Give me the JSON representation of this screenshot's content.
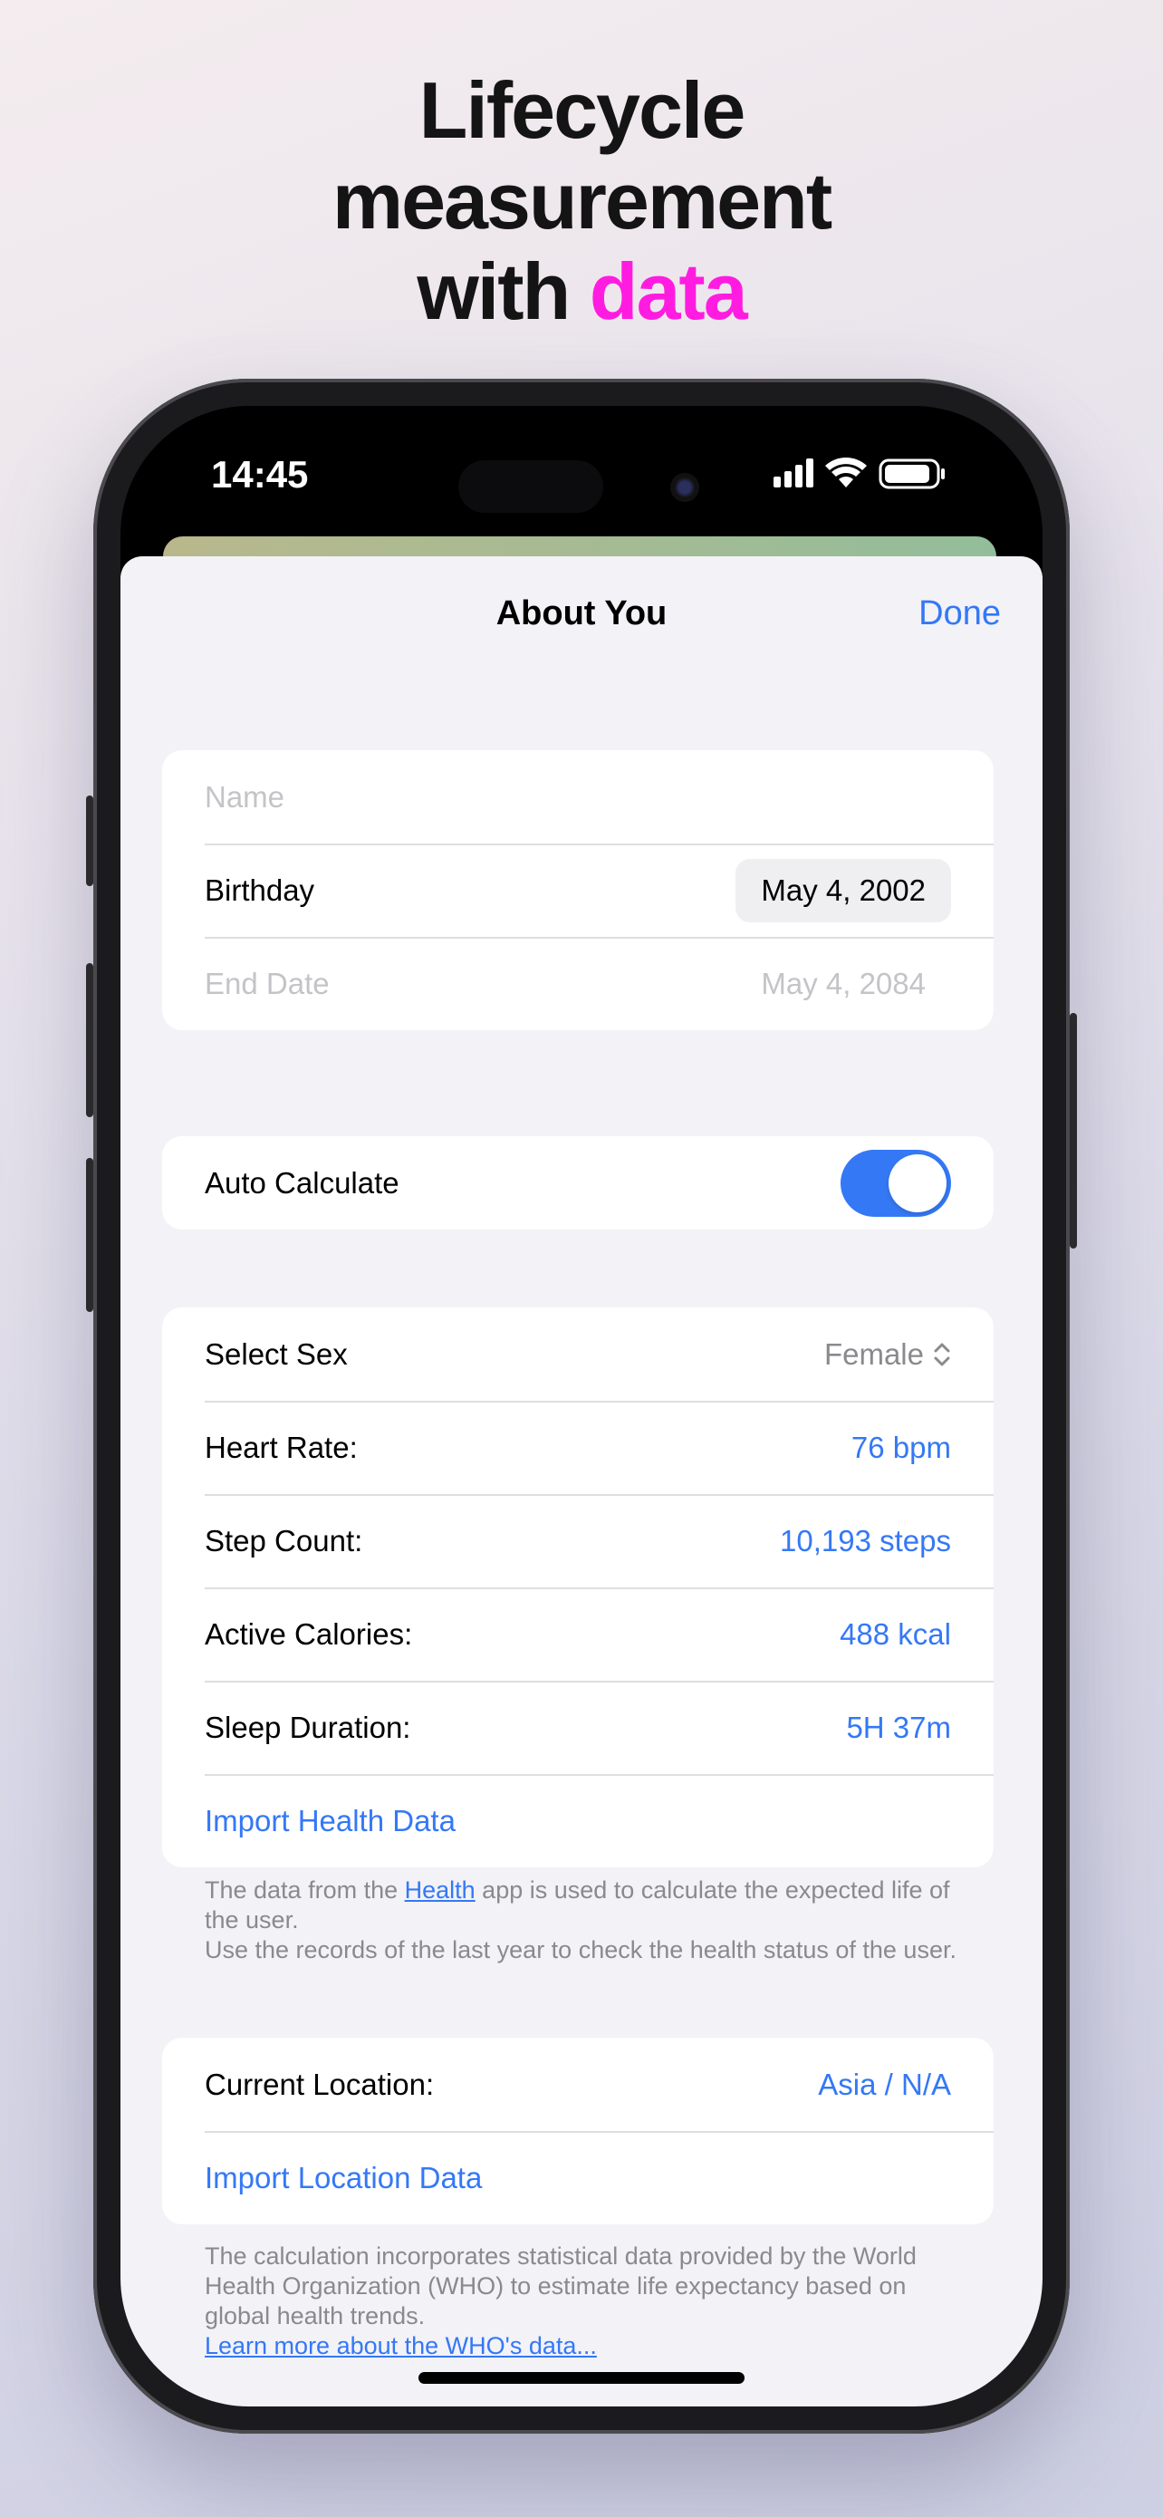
{
  "headline": {
    "line1": "Lifecycle",
    "line2": "measurement",
    "line3_prefix": "with ",
    "line3_accent": "data",
    "accent_color": "#ff1ce0"
  },
  "status_bar": {
    "time": "14:45",
    "icons": [
      "cellular-signal-icon",
      "wifi-icon",
      "battery-icon"
    ]
  },
  "nav": {
    "title": "About You",
    "done_label": "Done"
  },
  "profile": {
    "name_placeholder": "Name",
    "birthday_label": "Birthday",
    "birthday_value": "May 4, 2002",
    "end_date_label": "End Date",
    "end_date_value": "May 4, 2084"
  },
  "auto_calculate": {
    "label": "Auto Calculate",
    "enabled": true
  },
  "health": {
    "sex_label": "Select Sex",
    "sex_value": "Female",
    "heart_rate_label": "Heart Rate:",
    "heart_rate_value": "76 bpm",
    "step_count_label": "Step Count:",
    "step_count_value": "10,193 steps",
    "active_calories_label": "Active Calories:",
    "active_calories_value": "488 kcal",
    "sleep_label": "Sleep Duration:",
    "sleep_value": "5H 37m",
    "import_label": "Import Health Data"
  },
  "health_footnote": {
    "prefix": "The data from the ",
    "link": "Health",
    "suffix": " app is used to calculate the expected life of the user.",
    "line2": "Use the records of the last year to check the health status of the user."
  },
  "location": {
    "current_label": "Current Location:",
    "current_value": "Asia / N/A",
    "import_label": "Import Location Data"
  },
  "location_footnote": {
    "text": "The calculation incorporates statistical data provided by the World Health Organization (WHO) to estimate life expectancy based on global health trends.",
    "link": "Learn more about the WHO's data..."
  },
  "colors": {
    "accent_blue": "#3478f6",
    "background": "#f2f2f7"
  }
}
